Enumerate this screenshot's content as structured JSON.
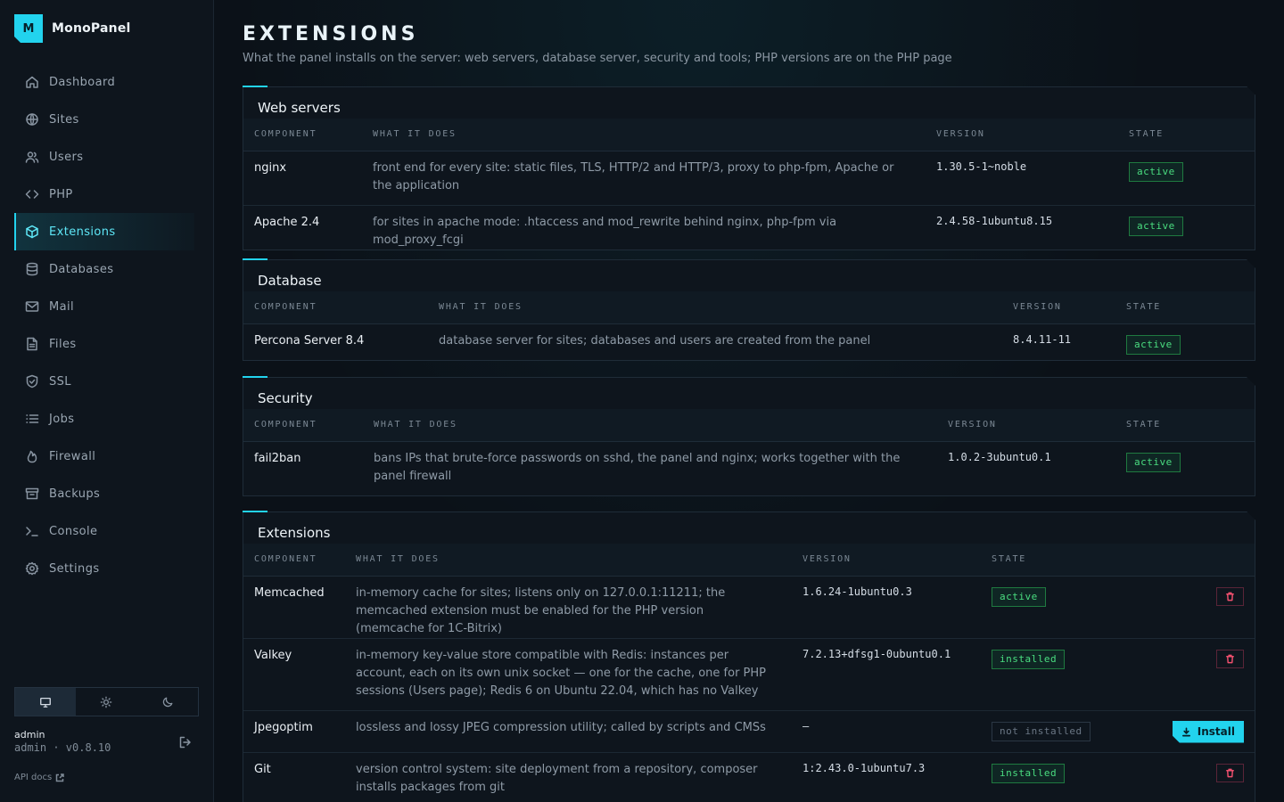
{
  "brand": {
    "logo_letter": "M",
    "name": "MonoPanel"
  },
  "sidebar": {
    "items": [
      {
        "label": "Dashboard",
        "icon": "home-icon"
      },
      {
        "label": "Sites",
        "icon": "globe-icon"
      },
      {
        "label": "Users",
        "icon": "users-icon"
      },
      {
        "label": "PHP",
        "icon": "code-icon"
      },
      {
        "label": "Extensions",
        "icon": "package-icon",
        "active": true
      },
      {
        "label": "Databases",
        "icon": "database-icon"
      },
      {
        "label": "Mail",
        "icon": "mail-icon"
      },
      {
        "label": "Files",
        "icon": "file-icon"
      },
      {
        "label": "SSL",
        "icon": "shield-icon"
      },
      {
        "label": "Jobs",
        "icon": "list-icon"
      },
      {
        "label": "Firewall",
        "icon": "flame-icon"
      },
      {
        "label": "Backups",
        "icon": "archive-icon"
      },
      {
        "label": "Console",
        "icon": "terminal-icon"
      },
      {
        "label": "Settings",
        "icon": "gear-icon"
      }
    ],
    "theme": {
      "options": [
        "monitor-icon",
        "sun-icon",
        "moon-icon"
      ],
      "active": "monitor-icon"
    },
    "user": {
      "name": "admin",
      "meta": "admin · v0.8.10"
    },
    "api_docs": "API docs"
  },
  "page": {
    "title": "EXTENSIONS",
    "subtitle": "What the panel installs on the server: web servers, database server, security and tools; PHP versions are on the PHP page"
  },
  "columns": {
    "component": "COMPONENT",
    "what": "WHAT IT DOES",
    "version": "VERSION",
    "state": "STATE"
  },
  "sections": {
    "web": {
      "title": "Web servers",
      "rows": [
        {
          "name": "nginx",
          "desc": "front end for every site: static files, TLS, HTTP/2 and HTTP/3, proxy to php-fpm, Apache or the application",
          "version": "1.30.5-1~noble",
          "state": "active"
        },
        {
          "name": "Apache 2.4",
          "desc": "for sites in apache mode: .htaccess and mod_rewrite behind nginx, php-fpm via mod_proxy_fcgi",
          "version": "2.4.58-1ubuntu8.15",
          "state": "active"
        }
      ]
    },
    "db": {
      "title": "Database",
      "rows": [
        {
          "name": "Percona Server 8.4",
          "desc": "database server for sites; databases and users are created from the panel",
          "version": "8.4.11-11",
          "state": "active"
        }
      ]
    },
    "security": {
      "title": "Security",
      "rows": [
        {
          "name": "fail2ban",
          "desc": "bans IPs that brute-force passwords on sshd, the panel and nginx; works together with the panel firewall",
          "version": "1.0.2-3ubuntu0.1",
          "state": "active"
        }
      ]
    },
    "ext": {
      "title": "Extensions",
      "install_label": "Install",
      "rows": [
        {
          "name": "Memcached",
          "desc": "in-memory cache for sites; listens only on 127.0.0.1:11211; the memcached extension must be enabled for the PHP version (memcache for 1C-Bitrix)",
          "version": "1.6.24-1ubuntu0.3",
          "state": "active"
        },
        {
          "name": "Valkey",
          "desc": "in-memory key-value store compatible with Redis: instances per account, each on its own unix socket — one for the cache, one for PHP sessions (Users page); Redis 6 on Ubuntu 22.04, which has no Valkey",
          "version": "7.2.13+dfsg1-0ubuntu0.1",
          "state": "installed"
        },
        {
          "name": "Jpegoptim",
          "desc": "lossless and lossy JPEG compression utility; called by scripts and CMSs",
          "version": "—",
          "state": "not installed"
        },
        {
          "name": "Git",
          "desc": "version control system: site deployment from a repository, composer installs packages from git",
          "version": "1:2.43.0-1ubuntu7.3",
          "state": "installed"
        }
      ]
    }
  }
}
